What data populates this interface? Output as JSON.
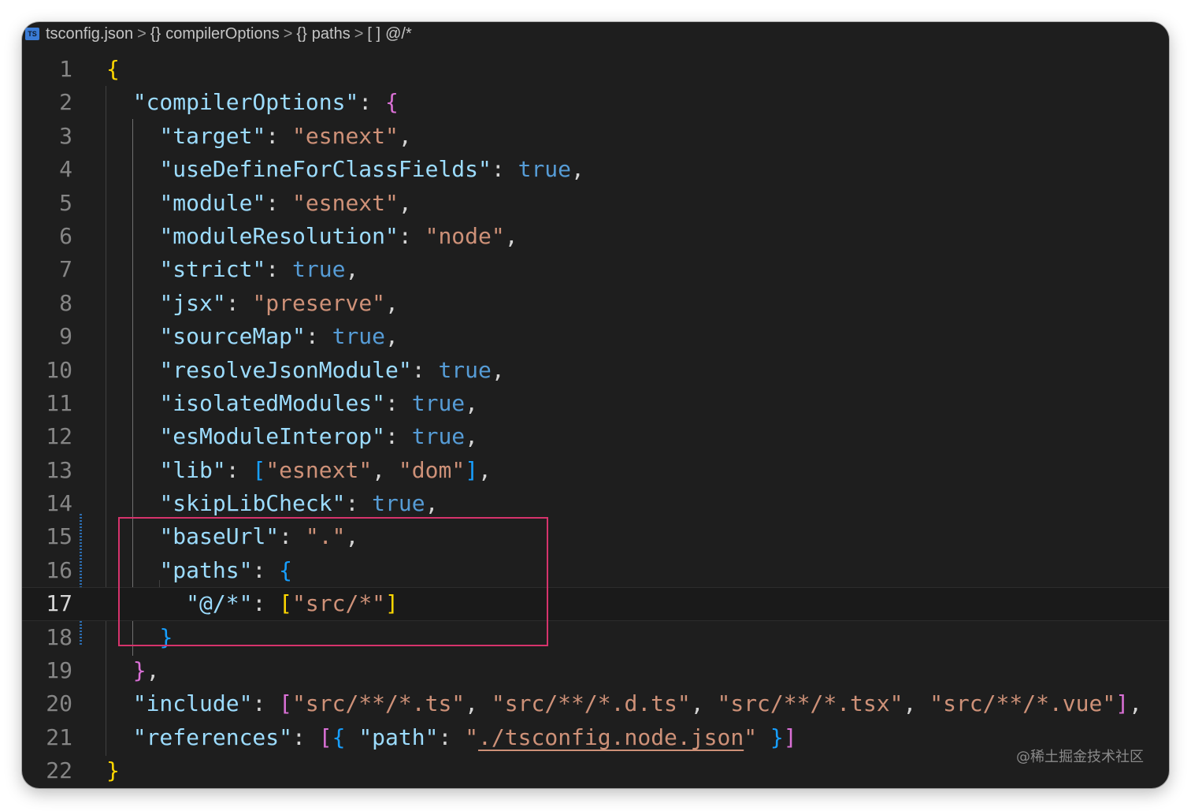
{
  "breadcrumb": {
    "file_icon": "TS",
    "file": "tsconfig.json",
    "sep": ">",
    "obj_glyph": "{}",
    "arr_glyph": "[ ]",
    "seg1": "compilerOptions",
    "seg2": "paths",
    "seg3": "@/*"
  },
  "lines": [
    {
      "n": "1",
      "tokens": [
        {
          "t": "{",
          "c": "y"
        }
      ]
    },
    {
      "n": "2",
      "tokens": [
        {
          "t": "  ",
          "c": "p"
        },
        {
          "t": "\"compilerOptions\"",
          "c": "k"
        },
        {
          "t": ": ",
          "c": "p"
        },
        {
          "t": "{",
          "c": "m"
        }
      ]
    },
    {
      "n": "3",
      "tokens": [
        {
          "t": "    ",
          "c": "p"
        },
        {
          "t": "\"target\"",
          "c": "k"
        },
        {
          "t": ": ",
          "c": "p"
        },
        {
          "t": "\"esnext\"",
          "c": "s"
        },
        {
          "t": ",",
          "c": "p"
        }
      ]
    },
    {
      "n": "4",
      "tokens": [
        {
          "t": "    ",
          "c": "p"
        },
        {
          "t": "\"useDefineForClassFields\"",
          "c": "k"
        },
        {
          "t": ": ",
          "c": "p"
        },
        {
          "t": "true",
          "c": "b"
        },
        {
          "t": ",",
          "c": "p"
        }
      ]
    },
    {
      "n": "5",
      "tokens": [
        {
          "t": "    ",
          "c": "p"
        },
        {
          "t": "\"module\"",
          "c": "k"
        },
        {
          "t": ": ",
          "c": "p"
        },
        {
          "t": "\"esnext\"",
          "c": "s"
        },
        {
          "t": ",",
          "c": "p"
        }
      ]
    },
    {
      "n": "6",
      "tokens": [
        {
          "t": "    ",
          "c": "p"
        },
        {
          "t": "\"moduleResolution\"",
          "c": "k"
        },
        {
          "t": ": ",
          "c": "p"
        },
        {
          "t": "\"node\"",
          "c": "s"
        },
        {
          "t": ",",
          "c": "p"
        }
      ]
    },
    {
      "n": "7",
      "tokens": [
        {
          "t": "    ",
          "c": "p"
        },
        {
          "t": "\"strict\"",
          "c": "k"
        },
        {
          "t": ": ",
          "c": "p"
        },
        {
          "t": "true",
          "c": "b"
        },
        {
          "t": ",",
          "c": "p"
        }
      ]
    },
    {
      "n": "8",
      "tokens": [
        {
          "t": "    ",
          "c": "p"
        },
        {
          "t": "\"jsx\"",
          "c": "k"
        },
        {
          "t": ": ",
          "c": "p"
        },
        {
          "t": "\"preserve\"",
          "c": "s"
        },
        {
          "t": ",",
          "c": "p"
        }
      ]
    },
    {
      "n": "9",
      "tokens": [
        {
          "t": "    ",
          "c": "p"
        },
        {
          "t": "\"sourceMap\"",
          "c": "k"
        },
        {
          "t": ": ",
          "c": "p"
        },
        {
          "t": "true",
          "c": "b"
        },
        {
          "t": ",",
          "c": "p"
        }
      ]
    },
    {
      "n": "10",
      "tokens": [
        {
          "t": "    ",
          "c": "p"
        },
        {
          "t": "\"resolveJsonModule\"",
          "c": "k"
        },
        {
          "t": ": ",
          "c": "p"
        },
        {
          "t": "true",
          "c": "b"
        },
        {
          "t": ",",
          "c": "p"
        }
      ]
    },
    {
      "n": "11",
      "tokens": [
        {
          "t": "    ",
          "c": "p"
        },
        {
          "t": "\"isolatedModules\"",
          "c": "k"
        },
        {
          "t": ": ",
          "c": "p"
        },
        {
          "t": "true",
          "c": "b"
        },
        {
          "t": ",",
          "c": "p"
        }
      ]
    },
    {
      "n": "12",
      "tokens": [
        {
          "t": "    ",
          "c": "p"
        },
        {
          "t": "\"esModuleInterop\"",
          "c": "k"
        },
        {
          "t": ": ",
          "c": "p"
        },
        {
          "t": "true",
          "c": "b"
        },
        {
          "t": ",",
          "c": "p"
        }
      ]
    },
    {
      "n": "13",
      "tokens": [
        {
          "t": "    ",
          "c": "p"
        },
        {
          "t": "\"lib\"",
          "c": "k"
        },
        {
          "t": ": ",
          "c": "p"
        },
        {
          "t": "[",
          "c": "bl"
        },
        {
          "t": "\"esnext\"",
          "c": "s"
        },
        {
          "t": ", ",
          "c": "p"
        },
        {
          "t": "\"dom\"",
          "c": "s"
        },
        {
          "t": "]",
          "c": "bl"
        },
        {
          "t": ",",
          "c": "p"
        }
      ]
    },
    {
      "n": "14",
      "tokens": [
        {
          "t": "    ",
          "c": "p"
        },
        {
          "t": "\"skipLibCheck\"",
          "c": "k"
        },
        {
          "t": ": ",
          "c": "p"
        },
        {
          "t": "true",
          "c": "b"
        },
        {
          "t": ",",
          "c": "p"
        }
      ]
    },
    {
      "n": "15",
      "tokens": [
        {
          "t": "    ",
          "c": "p"
        },
        {
          "t": "\"baseUrl\"",
          "c": "k"
        },
        {
          "t": ": ",
          "c": "p"
        },
        {
          "t": "\".\"",
          "c": "s"
        },
        {
          "t": ",",
          "c": "p"
        }
      ]
    },
    {
      "n": "16",
      "tokens": [
        {
          "t": "    ",
          "c": "p"
        },
        {
          "t": "\"paths\"",
          "c": "k"
        },
        {
          "t": ": ",
          "c": "p"
        },
        {
          "t": "{",
          "c": "bl"
        }
      ]
    },
    {
      "n": "17",
      "current": true,
      "tokens": [
        {
          "t": "      ",
          "c": "p"
        },
        {
          "t": "\"@/*\"",
          "c": "k"
        },
        {
          "t": ": ",
          "c": "p"
        },
        {
          "t": "[",
          "c": "y"
        },
        {
          "t": "\"src/*\"",
          "c": "s"
        },
        {
          "t": "]",
          "c": "y"
        }
      ]
    },
    {
      "n": "18",
      "tokens": [
        {
          "t": "    ",
          "c": "p"
        },
        {
          "t": "}",
          "c": "bl"
        }
      ]
    },
    {
      "n": "19",
      "tokens": [
        {
          "t": "  ",
          "c": "p"
        },
        {
          "t": "}",
          "c": "m"
        },
        {
          "t": ",",
          "c": "p"
        }
      ]
    },
    {
      "n": "20",
      "tokens": [
        {
          "t": "  ",
          "c": "p"
        },
        {
          "t": "\"include\"",
          "c": "k"
        },
        {
          "t": ": ",
          "c": "p"
        },
        {
          "t": "[",
          "c": "m"
        },
        {
          "t": "\"src/**/*.ts\"",
          "c": "s"
        },
        {
          "t": ", ",
          "c": "p"
        },
        {
          "t": "\"src/**/*.d.ts\"",
          "c": "s"
        },
        {
          "t": ", ",
          "c": "p"
        },
        {
          "t": "\"src/**/*.tsx\"",
          "c": "s"
        },
        {
          "t": ", ",
          "c": "p"
        },
        {
          "t": "\"src/**/*.vue\"",
          "c": "s"
        },
        {
          "t": "]",
          "c": "m"
        },
        {
          "t": ",",
          "c": "p"
        }
      ]
    },
    {
      "n": "21",
      "tokens": [
        {
          "t": "  ",
          "c": "p"
        },
        {
          "t": "\"references\"",
          "c": "k"
        },
        {
          "t": ": ",
          "c": "p"
        },
        {
          "t": "[",
          "c": "m"
        },
        {
          "t": "{ ",
          "c": "bl"
        },
        {
          "t": "\"path\"",
          "c": "k"
        },
        {
          "t": ": ",
          "c": "p"
        },
        {
          "t": "\"",
          "c": "s"
        },
        {
          "t": "./tsconfig.node.json",
          "c": "s u"
        },
        {
          "t": "\"",
          "c": "s"
        },
        {
          "t": " }",
          "c": "bl"
        },
        {
          "t": "]",
          "c": "m"
        }
      ]
    },
    {
      "n": "22",
      "tokens": [
        {
          "t": "}",
          "c": "y"
        }
      ]
    }
  ],
  "watermark": "@稀土掘金技术社区"
}
